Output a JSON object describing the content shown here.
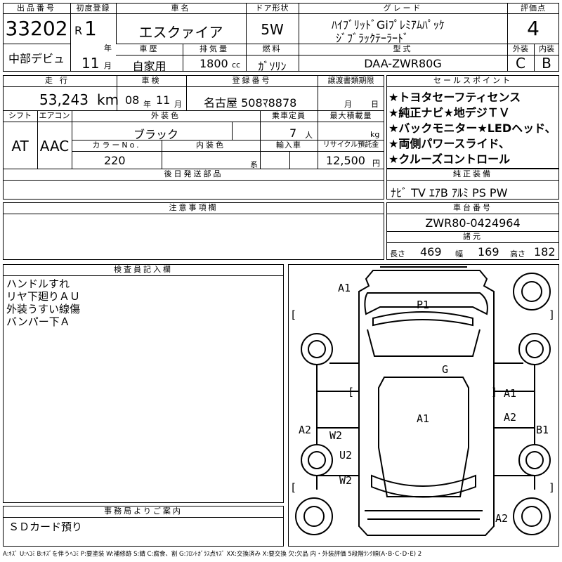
{
  "header": {
    "lot_label": "出品番号",
    "lot_number": "33202",
    "debut": "中部デビュ",
    "reg_label": "初度登録",
    "era": "R",
    "reg_year": "1",
    "year_unit": "年",
    "reg_month": "11",
    "month_unit": "月",
    "name_label": "車名",
    "car_name": "エスクァイア",
    "doors_label": "ドア形状",
    "doors": "5W",
    "grade_label": "グレード",
    "grade_line1": "ﾊｲﾌﾞﾘｯﾄﾞGiﾌﾟﾚﾐｱﾑﾊﾟｯｹ",
    "grade_line2": "ｼﾞﾌﾞﾗｯｸﾃｰﾗｰﾄﾞ",
    "score_label": "評価点",
    "score": "4",
    "history_label": "車歴",
    "history": "自家用",
    "disp_label": "排気量",
    "displacement": "1800",
    "disp_unit": "cc",
    "fuel_label": "燃料",
    "fuel": "ｶﾞｿﾘﾝ",
    "model_label": "型式",
    "model": "DAA-ZWR80G",
    "ext_label": "外装",
    "ext_grade": "C",
    "int_label": "内装",
    "int_grade": "B"
  },
  "row2": {
    "mileage_label": "走行",
    "mileage": "53,243",
    "mileage_unit": "km",
    "inspection_label": "車検",
    "insp_year": "08",
    "insp_year_unit": "年",
    "insp_month": "11",
    "insp_month_unit": "月",
    "plate_label": "登録番号",
    "plate": "名古屋 508ﾏ8878",
    "transfer_label": "譲渡書類期限",
    "transfer_month": "月",
    "transfer_day": "日",
    "shift_label": "シフト",
    "shift": "AT",
    "ac_label": "エアコン",
    "ac": "AAC",
    "color_label": "外装色",
    "color": "ブラック",
    "capacity_label": "乗車定員",
    "capacity": "7",
    "capacity_unit": "人",
    "load_label": "最大積載量",
    "load_unit": "kg",
    "colorno_label": "カラーNo.",
    "colorno": "220",
    "intcolor_label": "内装色",
    "intcolor_unit": "系",
    "import_label": "輸入車",
    "recycle_label": "リサイクル預託金",
    "recycle": "12,500",
    "recycle_unit": "円",
    "later_label": "後日発送部品"
  },
  "sales": {
    "label": "セールスポイント",
    "lines": [
      "★トヨタセーフティセンス",
      "★純正ナビ★地デジＴＶ",
      "★バックモニター★LEDヘッド、",
      "★両側パワースライド、",
      "★クルーズコントロール"
    ]
  },
  "equip": {
    "label": "純正装備",
    "value": "ﾅﾋﾞ TV ｴｱB ｱﾙﾐ PS PW"
  },
  "notes": {
    "label": "注意事項欄"
  },
  "chassis": {
    "label": "車台番号",
    "value": "ZWR80-0424964"
  },
  "dims": {
    "label": "諸元",
    "length_label": "長さ",
    "length": "469",
    "width_label": "幅",
    "width": "169",
    "height_label": "高さ",
    "height": "182"
  },
  "inspector": {
    "label": "検査員記入欄",
    "lines": [
      "ハンドルすれ",
      "リヤ下廻りＡＵ",
      "外装うすい線傷",
      "バンパー下Ａ"
    ]
  },
  "office": {
    "label": "事務局よりご案内",
    "text": "ＳＤカード預り"
  },
  "diagram": {
    "marks": {
      "a1_top": "A1",
      "p1": "P1",
      "g": "G",
      "a1_right": "A1",
      "a1_center": "A1",
      "a2_left": "A2",
      "a2_right": "A2",
      "b1_right": "B1",
      "w2_upper": "W2",
      "u2": "U2",
      "w2_lower": "W2",
      "a2_bottom": "A2"
    },
    "bracket_open": "[",
    "bracket_close": "]"
  },
  "legend": "A:ｷｽﾞ U:ﾍｺﾐ B:ｷｽﾞを伴うﾍｺﾐ P:要塗装 W:補修跡 S:錆 C:腐食、割 G:ﾌﾛﾝﾄｶﾞﾗｽ点ｷｽﾞ XX:交換済み X:要交換 欠:欠品 内・外装評価 5段階ﾗﾝｸ順(A･B･C･D･E) 2"
}
